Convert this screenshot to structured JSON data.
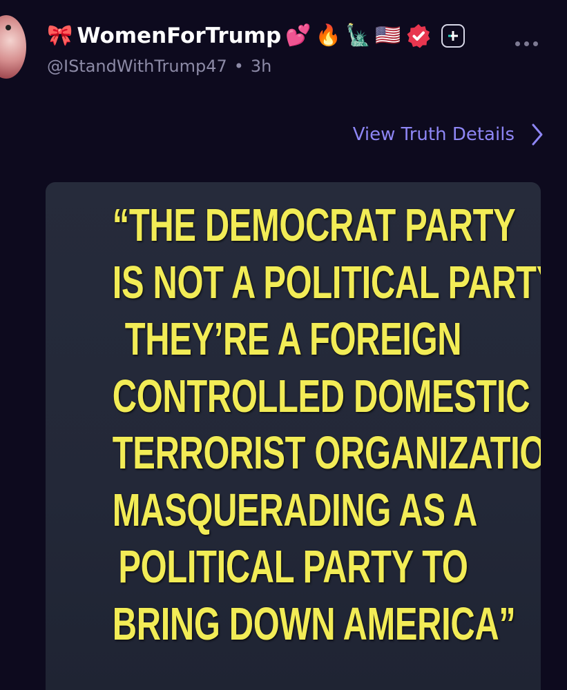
{
  "post": {
    "author": {
      "display_name": "WomenForTrump",
      "name_emoji_prefix": "🎀",
      "name_emoji_suffix": [
        "💕",
        "🔥",
        "🗽",
        "🇺🇸"
      ],
      "handle": "@IStandWithTrump47",
      "separator": "•",
      "time_ago": "3h"
    },
    "icons": {
      "verified": "verified-badge-icon",
      "plus": "plus-badge-icon",
      "more": "more-options-icon",
      "chevron": "chevron-right-icon"
    },
    "details_link": "View Truth Details",
    "image_quote_lines": [
      "“THE DEMOCRAT PARTY",
      "IS NOT A POLITICAL PARTY,",
      "THEY’RE A FOREIGN",
      "CONTROLLED DOMESTIC",
      "TERRORIST ORGANIZATION",
      "MASQUERADING AS A",
      "POLITICAL PARTY TO",
      "BRING DOWN AMERICA”"
    ]
  },
  "colors": {
    "background": "#0d0a1e",
    "link": "#8e86f5",
    "quote_text": "#f2ec56",
    "verified": "#e8364f"
  }
}
